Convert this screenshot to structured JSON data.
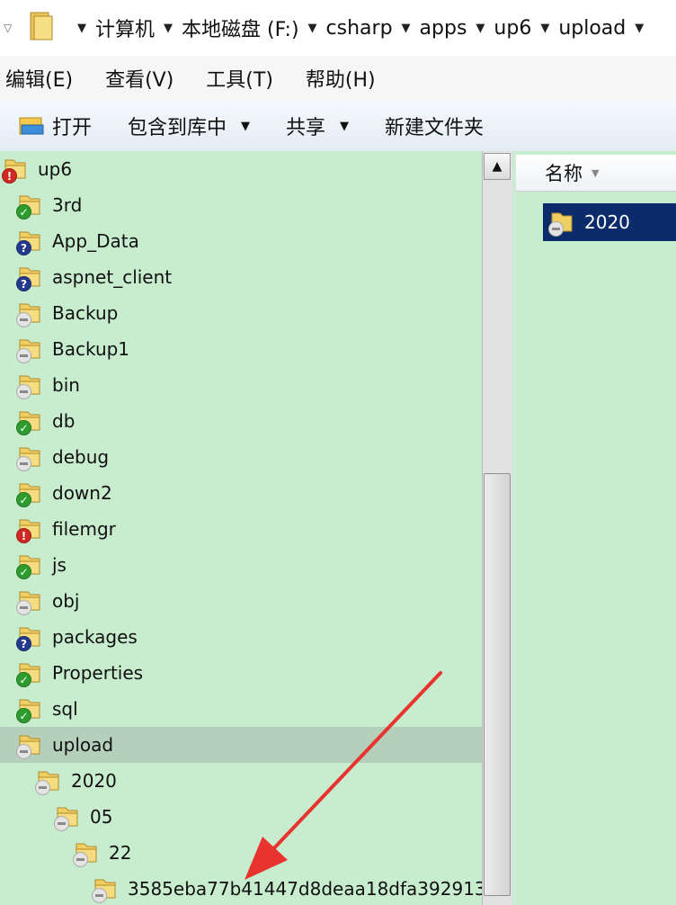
{
  "address": {
    "crumbs": [
      "计算机",
      "本地磁盘 (F:)",
      "csharp",
      "apps",
      "up6",
      "upload"
    ]
  },
  "menu": [
    "编辑(E)",
    "查看(V)",
    "工具(T)",
    "帮助(H)"
  ],
  "toolbar": {
    "open": "打开",
    "include_library": "包含到库中",
    "share": "共享",
    "new_folder": "新建文件夹"
  },
  "tree": [
    {
      "label": "up6",
      "badge": "err",
      "indent": 0
    },
    {
      "label": "3rd",
      "badge": "ok",
      "indent": 1
    },
    {
      "label": "App_Data",
      "badge": "q",
      "indent": 1
    },
    {
      "label": "aspnet_client",
      "badge": "q",
      "indent": 1
    },
    {
      "label": "Backup",
      "badge": "none",
      "indent": 1
    },
    {
      "label": "Backup1",
      "badge": "none",
      "indent": 1
    },
    {
      "label": "bin",
      "badge": "none",
      "indent": 1
    },
    {
      "label": "db",
      "badge": "ok",
      "indent": 1
    },
    {
      "label": "debug",
      "badge": "none",
      "indent": 1
    },
    {
      "label": "down2",
      "badge": "ok",
      "indent": 1
    },
    {
      "label": "filemgr",
      "badge": "err",
      "indent": 1
    },
    {
      "label": "js",
      "badge": "ok",
      "indent": 1
    },
    {
      "label": "obj",
      "badge": "none",
      "indent": 1
    },
    {
      "label": "packages",
      "badge": "q",
      "indent": 1
    },
    {
      "label": "Properties",
      "badge": "ok",
      "indent": 1
    },
    {
      "label": "sql",
      "badge": "ok",
      "indent": 1
    },
    {
      "label": "upload",
      "badge": "none",
      "indent": 1,
      "selected": true
    },
    {
      "label": "2020",
      "badge": "none",
      "indent": 2
    },
    {
      "label": "05",
      "badge": "none",
      "indent": 3
    },
    {
      "label": "22",
      "badge": "none",
      "indent": 4
    },
    {
      "label": "3585eba77b41447d8deaa18dfa392913",
      "badge": "none",
      "indent": 5
    }
  ],
  "content": {
    "column_name": "名称",
    "items": [
      "2020"
    ]
  },
  "colors": {
    "pane_bg": "#c8ecce",
    "selection": "#0b2b6a",
    "annotation_arrow": "#e8332f"
  }
}
